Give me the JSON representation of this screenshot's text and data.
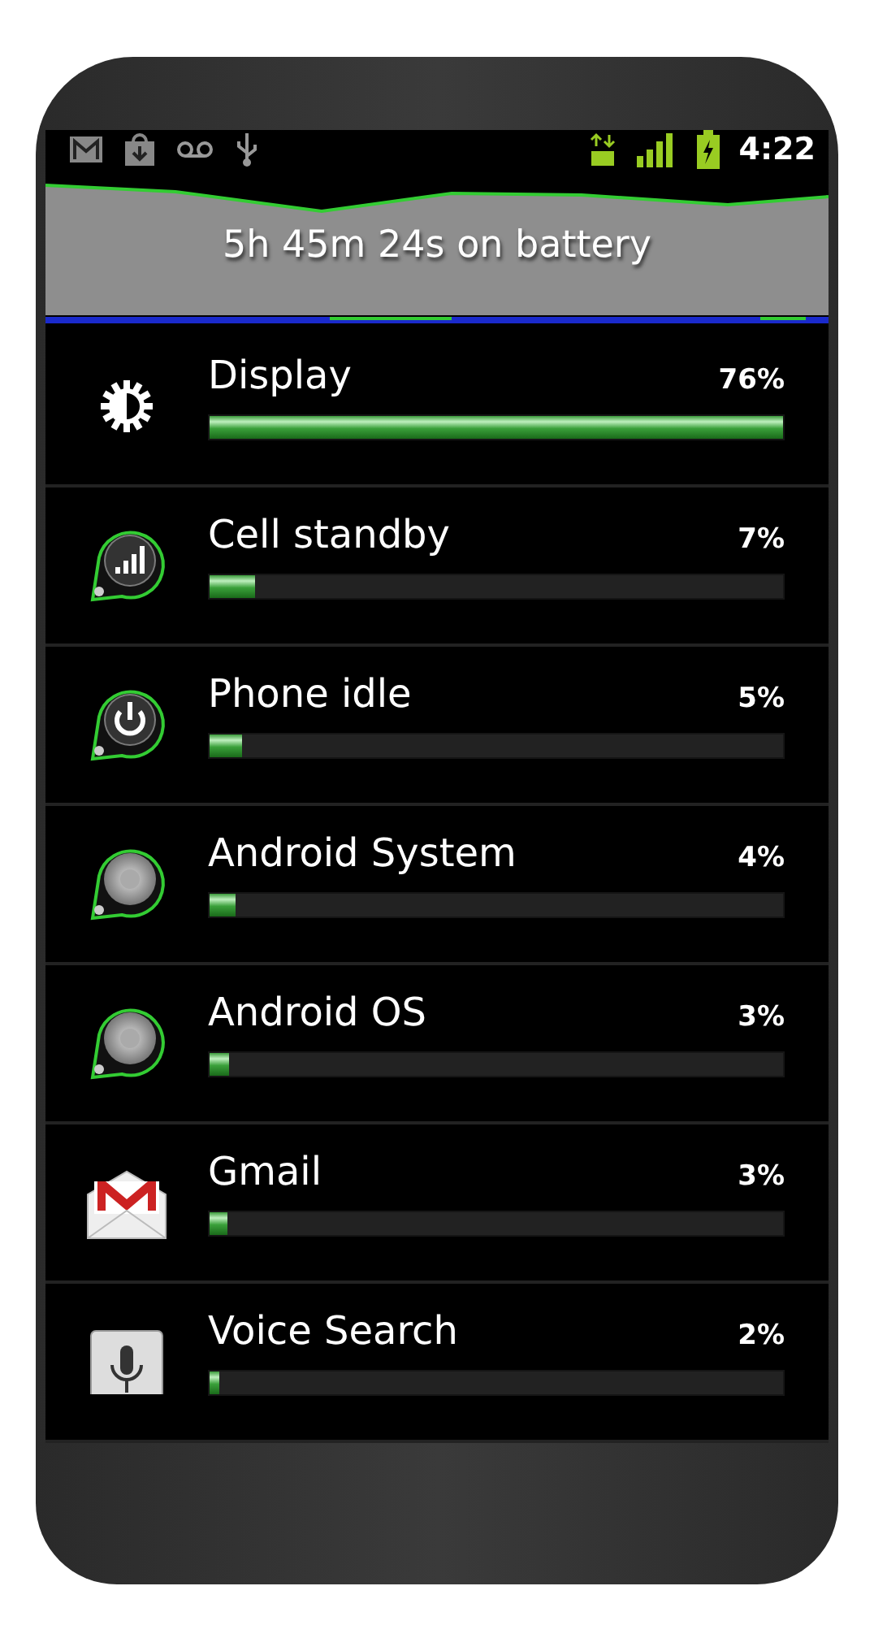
{
  "status_bar": {
    "time": "4:22"
  },
  "battery_summary": "5h 45m 24s on battery",
  "usage": [
    {
      "kind": "display",
      "name": "Display",
      "percent": "76%",
      "level": 1.0
    },
    {
      "kind": "signal",
      "name": "Cell standby",
      "percent": "7%",
      "level": 0.08
    },
    {
      "kind": "power",
      "name": "Phone idle",
      "percent": "5%",
      "level": 0.057
    },
    {
      "kind": "system",
      "name": "Android System",
      "percent": "4%",
      "level": 0.045
    },
    {
      "kind": "system",
      "name": "Android OS",
      "percent": "3%",
      "level": 0.033
    },
    {
      "kind": "mail",
      "name": "Gmail",
      "percent": "3%",
      "level": 0.03
    },
    {
      "kind": "mic",
      "name": "Voice Search",
      "percent": "2%",
      "level": 0.018
    }
  ]
}
